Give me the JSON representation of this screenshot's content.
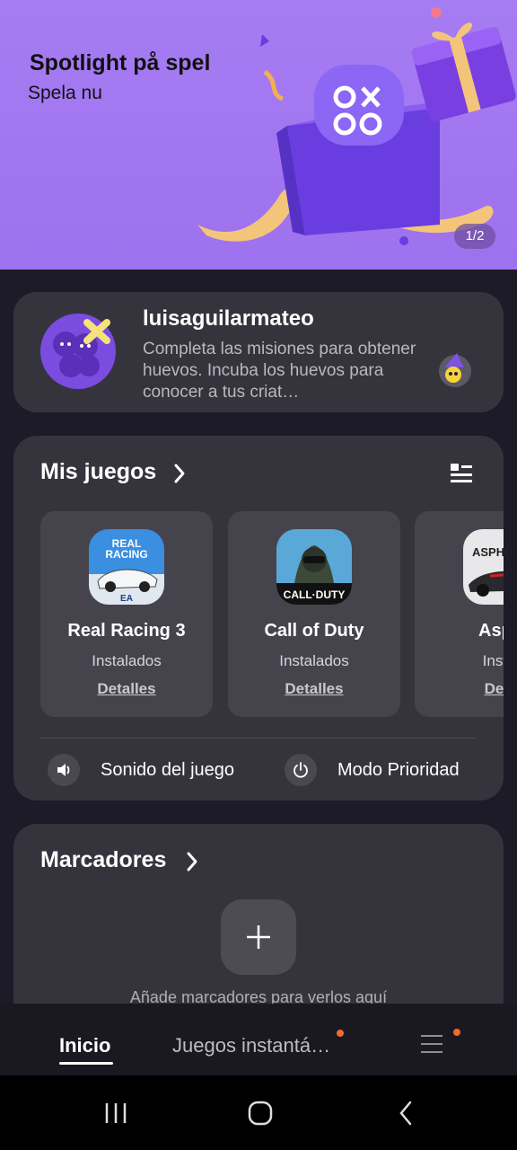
{
  "banner": {
    "title": "Spotlight på spel",
    "subtitle": "Spela nu",
    "pager": "1/2"
  },
  "profile": {
    "username": "luisaguilarmateo",
    "description": "Completa las misiones para obtener huevos. Incuba los huevos para conocer a tus criat…"
  },
  "my_games": {
    "title": "Mis juegos",
    "games": [
      {
        "name": "Real Racing 3",
        "status": "Instalados",
        "link": "Detalles"
      },
      {
        "name": "Call of Duty",
        "status": "Instalados",
        "link": "Detalles"
      },
      {
        "name": "Asph",
        "status": "Instal",
        "link": "Deta"
      }
    ],
    "tools": [
      {
        "label": "Sonido del juego",
        "icon": "speaker-icon"
      },
      {
        "label": "Modo Prioridad",
        "icon": "power-icon"
      }
    ]
  },
  "bookmarks": {
    "title": "Marcadores",
    "hint": "Añade marcadores para verlos aquí"
  },
  "bottom_nav": {
    "tabs": [
      {
        "label": "Inicio",
        "active": true
      },
      {
        "label": "Juegos instantá…",
        "active": false
      }
    ],
    "menu_icon": "hamburger-icon",
    "badge_color": "#f26a2c"
  },
  "system_nav": [
    "recents-icon",
    "home-icon",
    "back-icon"
  ],
  "colors": {
    "banner": "#a67cf2",
    "background": "#1c1b27",
    "card": "#35343d",
    "tile": "#45444d"
  }
}
